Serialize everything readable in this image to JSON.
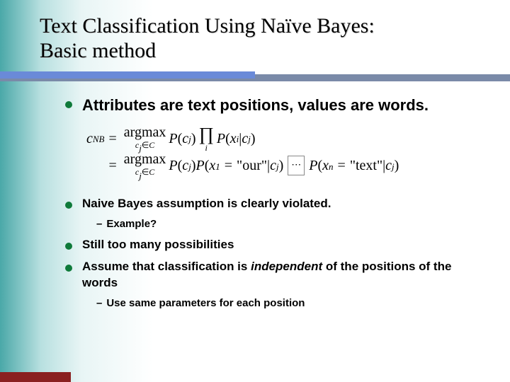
{
  "title_line1": "Text Classification Using Naïve Bayes:",
  "title_line2": "Basic method",
  "bullets": {
    "b1": "Attributes are text positions, values are words.",
    "b2": "Naive Bayes assumption is clearly violated.",
    "b2_sub": "Example?",
    "b3": "Still too many possibilities",
    "b4a": "Assume that classification is ",
    "b4_em": "independent",
    "b4b": " of the positions of the words",
    "b4_sub": "Use same parameters for each position"
  },
  "formula": {
    "lhs": "c",
    "lhs_sub": "NB",
    "argmax": "argmax",
    "domain": "c_j ∈ C",
    "p": "P",
    "cj": "c",
    "cj_sub": "j",
    "xi": "x",
    "xi_sub": "i",
    "x1": "x",
    "x1_sub": "1",
    "xn": "x",
    "xn_sub": "n",
    "q_our": "\"our\"",
    "q_text": "\"text\"",
    "prod_sub": "i",
    "bar": "|",
    "eq_sign": "="
  }
}
